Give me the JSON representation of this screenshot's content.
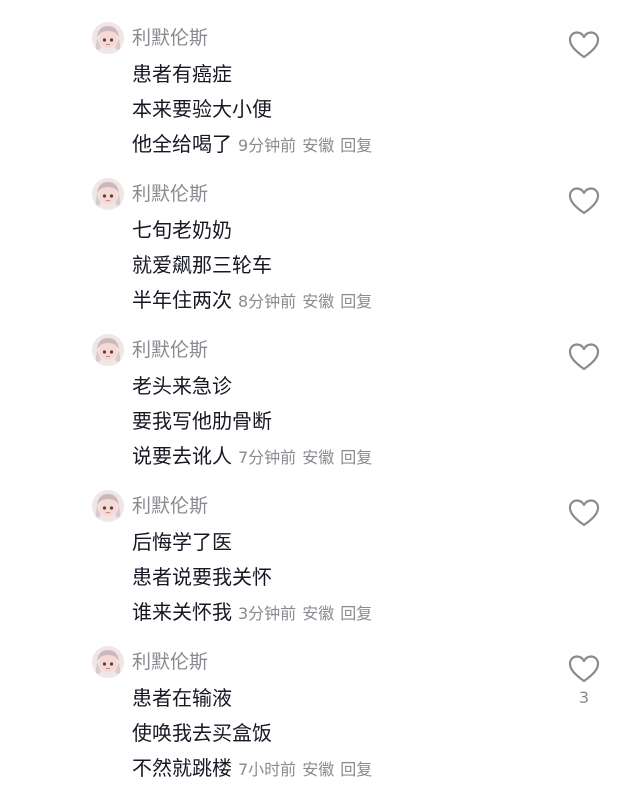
{
  "comments": [
    {
      "username": "利默伦斯",
      "lines": [
        "患者有癌症",
        "本来要验大小便",
        "他全给喝了"
      ],
      "time": "9分钟前",
      "location": "安徽",
      "reply_label": "回复",
      "like_count": ""
    },
    {
      "username": "利默伦斯",
      "lines": [
        "七旬老奶奶",
        "就爱飙那三轮车",
        "半年住两次"
      ],
      "time": "8分钟前",
      "location": "安徽",
      "reply_label": "回复",
      "like_count": ""
    },
    {
      "username": "利默伦斯",
      "lines": [
        "老头来急诊",
        "要我写他肋骨断",
        "说要去讹人"
      ],
      "time": "7分钟前",
      "location": "安徽",
      "reply_label": "回复",
      "like_count": ""
    },
    {
      "username": "利默伦斯",
      "lines": [
        "后悔学了医",
        "患者说要我关怀",
        "谁来关怀我"
      ],
      "time": "3分钟前",
      "location": "安徽",
      "reply_label": "回复",
      "like_count": ""
    },
    {
      "username": "利默伦斯",
      "lines": [
        "患者在输液",
        "使唤我去买盒饭",
        "不然就跳楼"
      ],
      "time": "7小时前",
      "location": "安徽",
      "reply_label": "回复",
      "like_count": "3"
    }
  ],
  "icons": {
    "like": "heart-outline-icon",
    "avatar": "avatar-anime-girl"
  },
  "colors": {
    "text": "#161823",
    "secondary": "#8a8b91"
  }
}
